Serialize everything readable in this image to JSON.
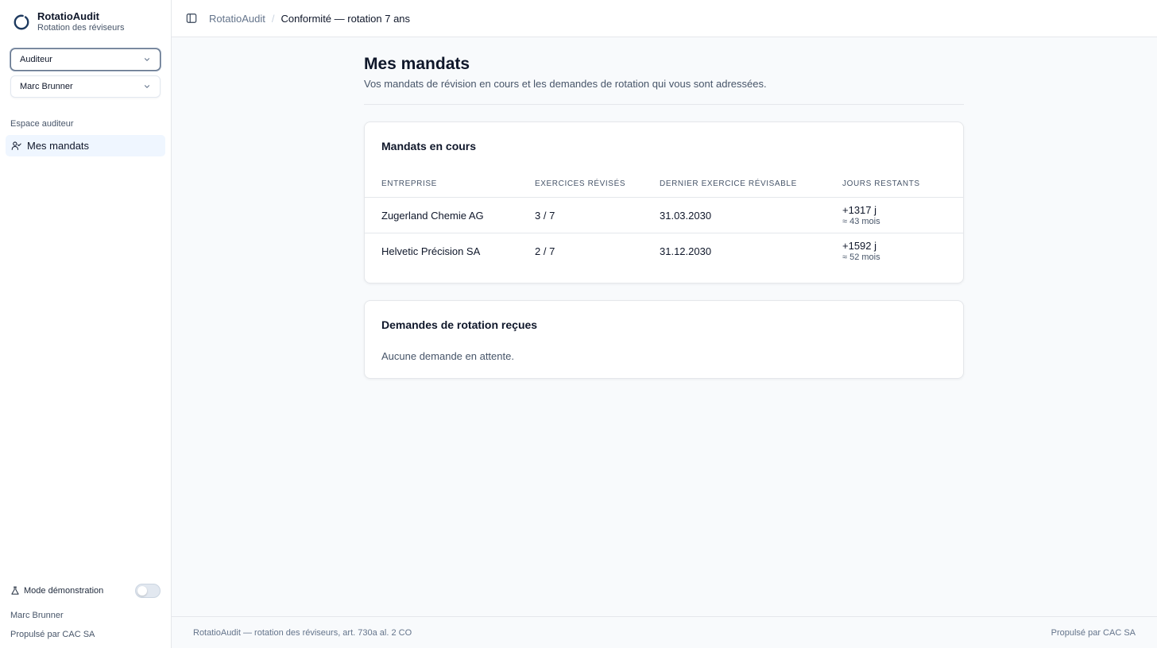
{
  "brand": {
    "name": "RotatioAudit",
    "subtitle": "Rotation des réviseurs"
  },
  "sidebar": {
    "role_select": {
      "value": "Auditeur"
    },
    "user_select": {
      "value": "Marc Brunner"
    },
    "section_label": "Espace auditeur",
    "items": [
      {
        "label": "Mes mandats",
        "icon": "user-check-icon",
        "active": true
      }
    ],
    "demo_mode": {
      "label": "Mode démonstration",
      "enabled": false
    },
    "footer_user": "Marc Brunner",
    "footer_powered": "Propulsé par CAC SA"
  },
  "topbar": {
    "breadcrumb_root": "RotatioAudit",
    "breadcrumb_separator": "/",
    "breadcrumb_current": "Conformité — rotation 7 ans"
  },
  "page": {
    "title": "Mes mandats",
    "description": "Vos mandats de révision en cours et les demandes de rotation qui vous sont adressées."
  },
  "mandates_card": {
    "title": "Mandats en cours",
    "columns": [
      "Entreprise",
      "Exercices révisés",
      "Dernier exercice révisable",
      "Jours restants"
    ],
    "rows": [
      {
        "company": "Zugerland Chemie AG",
        "exercises": "3 / 7",
        "last_exercise": "31.03.2030",
        "days": "+1317 j",
        "months": "≈ 43 mois"
      },
      {
        "company": "Helvetic Précision SA",
        "exercises": "2 / 7",
        "last_exercise": "31.12.2030",
        "days": "+1592 j",
        "months": "≈ 52 mois"
      }
    ]
  },
  "requests_card": {
    "title": "Demandes de rotation reçues",
    "empty_text": "Aucune demande en attente."
  },
  "footer": {
    "left": "RotatioAudit — rotation des réviseurs, art. 730a al. 2 CO",
    "right": "Propulsé par CAC SA"
  },
  "colors": {
    "accent_bg": "#eff6ff",
    "border": "#e5e7eb",
    "text": "#0f172a",
    "muted": "#475569",
    "logo": "#1e3a5f"
  }
}
